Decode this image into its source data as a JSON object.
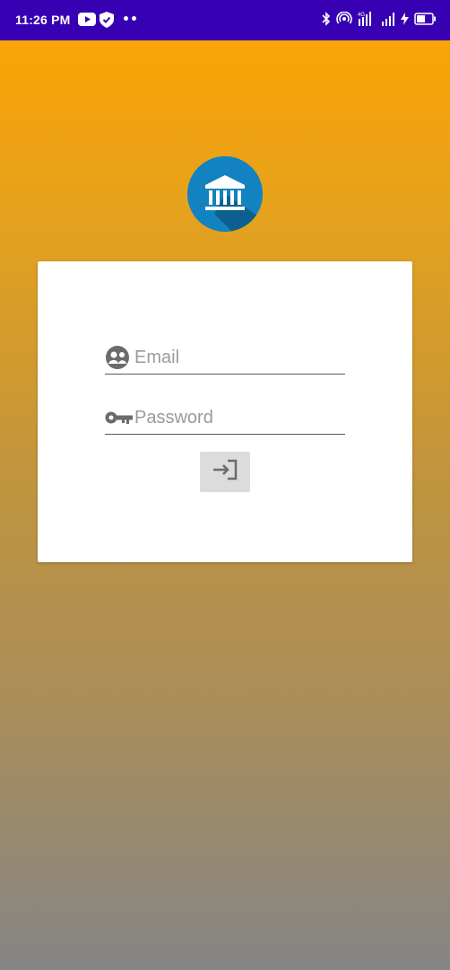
{
  "status_bar": {
    "time": "11:26 PM",
    "icons": [
      "youtube-icon",
      "shield-icon",
      "dots-icon",
      "bluetooth-icon",
      "hotspot-icon",
      "4g-signal-icon",
      "signal-icon",
      "charging-icon",
      "battery-icon"
    ]
  },
  "app": {
    "logo_icon": "bank-icon",
    "logo_color": "#1282c0"
  },
  "login_form": {
    "email_placeholder": "Email",
    "password_placeholder": "Password",
    "email_icon": "account-circle-icon",
    "password_icon": "key-icon",
    "submit_icon": "login-icon"
  },
  "colors": {
    "status_bar": "#3700b3",
    "gradient_top": "#ffa400",
    "gradient_bottom": "#858585",
    "card": "#ffffff"
  }
}
